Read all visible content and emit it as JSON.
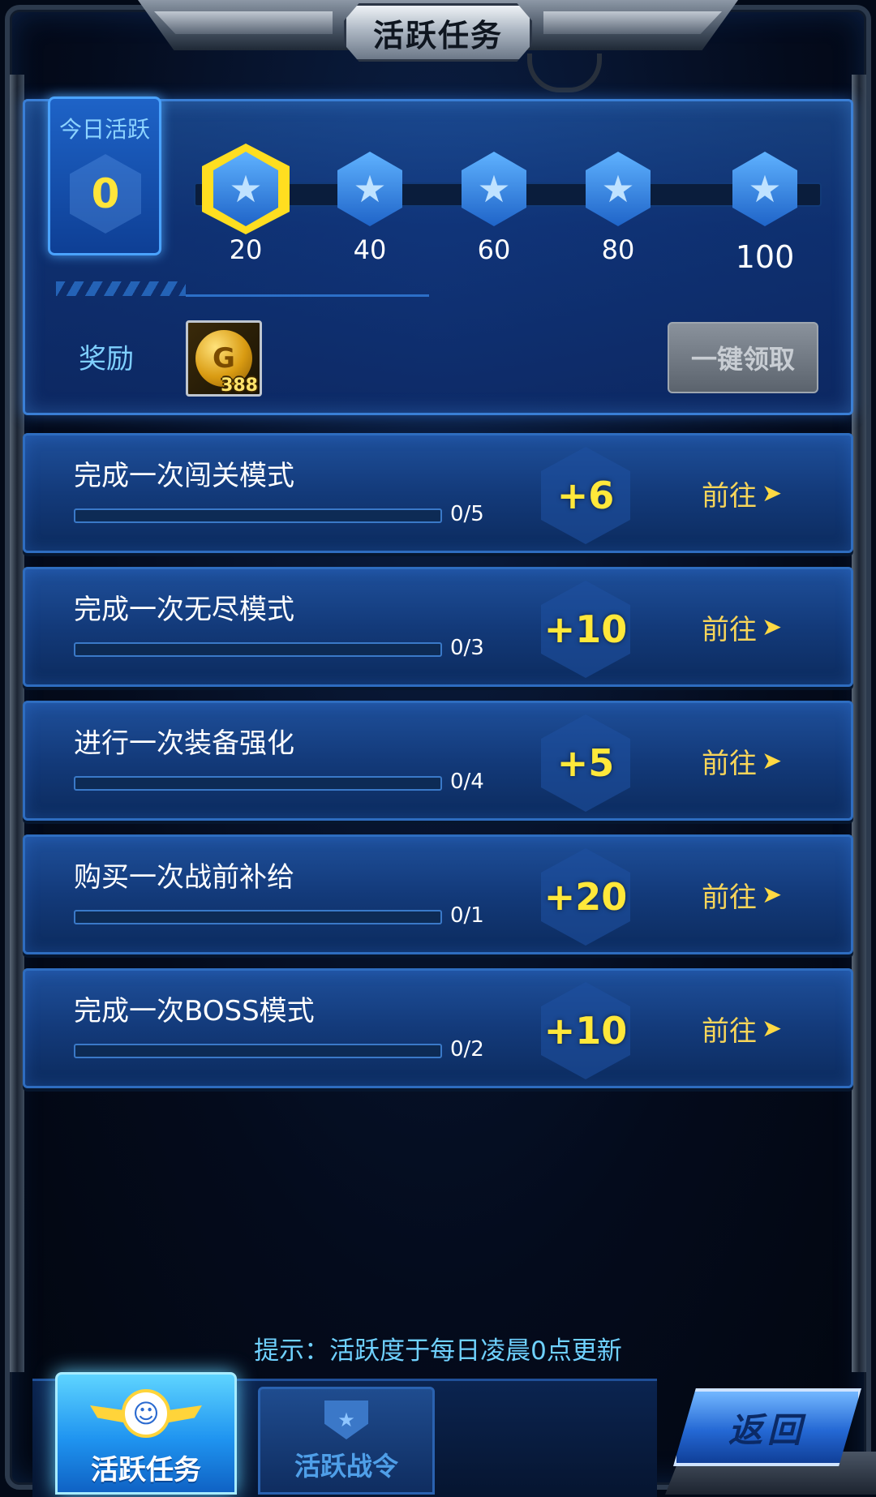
{
  "header": {
    "title": "活跃任务"
  },
  "activity": {
    "label": "今日活跃",
    "value": "0",
    "milestones": [
      {
        "value": "20",
        "highlighted": true
      },
      {
        "value": "40",
        "highlighted": false
      },
      {
        "value": "60",
        "highlighted": false
      },
      {
        "value": "80",
        "highlighted": false
      },
      {
        "value": "100",
        "highlighted": false
      }
    ],
    "milestone_icon": "star-icon",
    "reward_label": "奖励",
    "reward_item": {
      "icon": "gold-coin-icon",
      "count": "388"
    },
    "claim_all_label": "一键领取"
  },
  "tasks": [
    {
      "title": "完成一次闯关模式",
      "progress": "0/5",
      "progress_fraction": 0,
      "points": "+6",
      "go_label": "前往"
    },
    {
      "title": "完成一次无尽模式",
      "progress": "0/3",
      "progress_fraction": 0,
      "points": "+10",
      "go_label": "前往"
    },
    {
      "title": "进行一次装备强化",
      "progress": "0/4",
      "progress_fraction": 0,
      "points": "+5",
      "go_label": "前往"
    },
    {
      "title": "购买一次战前补给",
      "progress": "0/1",
      "progress_fraction": 0,
      "points": "+20",
      "go_label": "前往"
    },
    {
      "title": "完成一次BOSS模式",
      "progress": "0/2",
      "progress_fraction": 0,
      "points": "+10",
      "go_label": "前往"
    }
  ],
  "tip": "提示：活跃度于每日凌晨0点更新",
  "bottom_tabs": [
    {
      "label": "活跃任务",
      "icon": "smiley-wings-icon",
      "active": true
    },
    {
      "label": "活跃战令",
      "icon": "star-badge-icon",
      "active": false
    }
  ],
  "back_button": {
    "label": "返回"
  },
  "colors": {
    "accent_yellow": "#ffe53a",
    "panel_blue": "#1e4f9a",
    "tip_cyan": "#6fd1ff"
  }
}
